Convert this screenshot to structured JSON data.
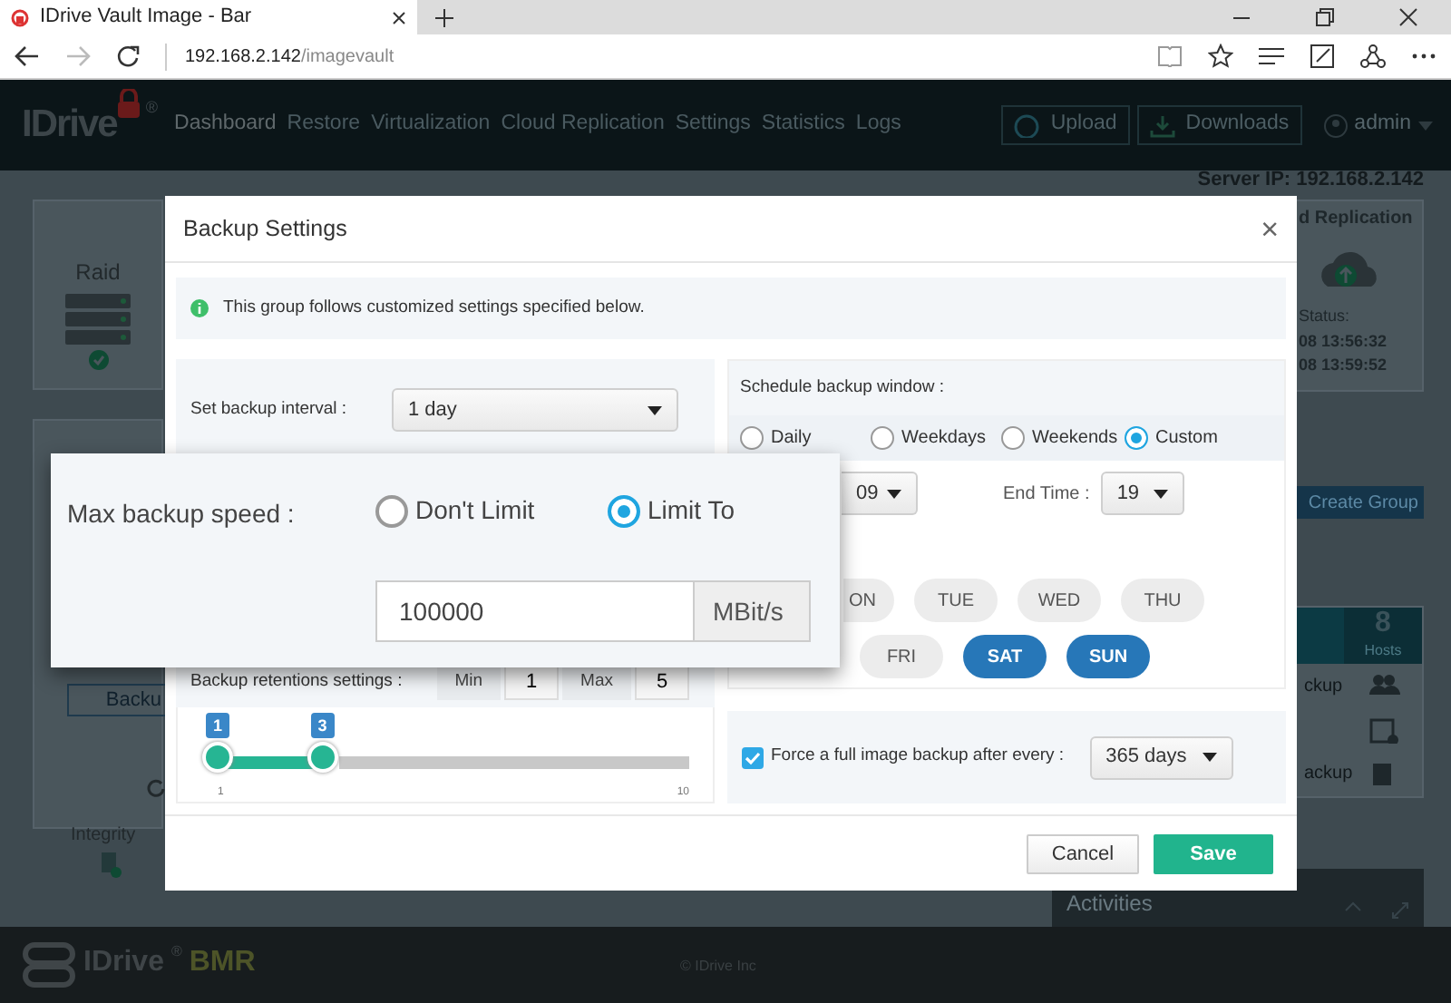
{
  "browser": {
    "tab_title": "IDrive Vault Image - Bar",
    "url_host": "192.168.2.142",
    "url_path": "/imagevault"
  },
  "navbar": {
    "logo": "IDrive",
    "logo_mark": "®",
    "links": [
      {
        "label": "Dashboard",
        "selected": true
      },
      {
        "label": "Restore",
        "selected": false
      },
      {
        "label": "Virtualization",
        "selected": false
      },
      {
        "label": "Cloud Replication",
        "selected": false
      },
      {
        "label": "Settings",
        "selected": false
      },
      {
        "label": "Statistics",
        "selected": false
      },
      {
        "label": "Logs",
        "selected": false
      }
    ],
    "buttons": [
      "Upload",
      "Downloads"
    ],
    "user": "admin"
  },
  "dashboard": {
    "server_ip": "Server IP: 192.168.2.142",
    "raid_label": "Raid",
    "backup_button": "Backu",
    "integrity_label": "Integrity",
    "replication_title": "d Replication",
    "status_label": "Status:",
    "status_times": [
      "08 13:56:32",
      "08 13:59:52"
    ],
    "create_group": "Create Group",
    "hosts_count": "8",
    "hosts_label": "Hosts",
    "side_items": [
      "ckup",
      "ackup"
    ],
    "activities": "Activities"
  },
  "footer": {
    "brand": "IDrive",
    "brand_mark": "®",
    "product": "BMR",
    "copyright": "© IDrive Inc"
  },
  "modal": {
    "title": "Backup Settings",
    "close": "×",
    "info": "This group follows customized settings specified below.",
    "interval": {
      "label": "Set backup interval :",
      "value": "1 day"
    },
    "retention": {
      "label": "Backup retentions settings :",
      "fields": [
        {
          "label": "Min",
          "value": "1"
        },
        {
          "label": "Max",
          "value": "5"
        }
      ],
      "slider": {
        "handles": [
          {
            "label": "1",
            "level": 0
          },
          {
            "label": "3",
            "level": 0.222
          }
        ],
        "tick_labels": [
          "1",
          "10"
        ]
      }
    },
    "schedule": {
      "title": "Schedule backup window :",
      "options": [
        {
          "label": "Daily",
          "selected": false
        },
        {
          "label": "Weekdays",
          "selected": false
        },
        {
          "label": "Weekends",
          "selected": false
        },
        {
          "label": "Custom",
          "selected": true
        }
      ],
      "start_time": "09",
      "end_time": {
        "label": "End Time :",
        "value": "19"
      },
      "days": [
        {
          "label": "ON",
          "selected": false
        },
        {
          "label": "TUE",
          "selected": false
        },
        {
          "label": "WED",
          "selected": false
        },
        {
          "label": "THU",
          "selected": false
        },
        {
          "label": "FRI",
          "selected": false
        },
        {
          "label": "SAT",
          "selected": true
        },
        {
          "label": "SUN",
          "selected": true
        }
      ]
    },
    "force_full": {
      "label": "Force a full image backup after every :",
      "checked": true,
      "value": "365 days"
    },
    "buttons": [
      {
        "label": "Cancel",
        "kind": "secondary"
      },
      {
        "label": "Save",
        "kind": "primary"
      }
    ]
  },
  "callout": {
    "label": "Max backup speed :",
    "options": [
      {
        "label": "Don't Limit",
        "selected": false
      },
      {
        "label": "Limit To",
        "selected": true
      }
    ],
    "value": "100000",
    "unit": "MBit/s"
  }
}
